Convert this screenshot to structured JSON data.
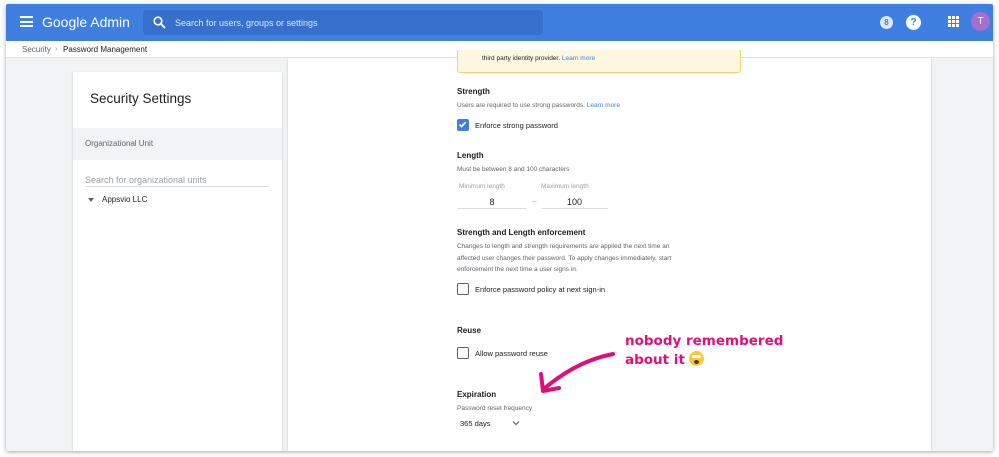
{
  "topbar": {
    "brand": "Google Admin",
    "search_placeholder": "Search for users, groups or settings",
    "notification_count": "8",
    "help_symbol": "?",
    "avatar_initial": "T",
    "color": "#3f7fe0",
    "icons": [
      "menu-icon",
      "search-icon",
      "help-icon",
      "apps-grid-icon"
    ]
  },
  "breadcrumb": {
    "items": [
      "Security",
      "Password Management"
    ],
    "separator": "›"
  },
  "sidebar": {
    "title": "Security Settings",
    "org_unit_label": "Organizational Unit",
    "search_placeholder": "Search for organizational units",
    "org_name": "Appsvio LLC"
  },
  "main": {
    "info_banner": {
      "text": "third party identity provider.",
      "link": "Learn more"
    },
    "strength": {
      "title": "Strength",
      "desc": "Users are required to use strong passwords.",
      "link": "Learn more",
      "checkbox_label": "Enforce strong password",
      "checked": true
    },
    "length": {
      "title": "Length",
      "desc": "Must be between 8 and 100 characters",
      "min_label": "Minimum length",
      "min_value": "8",
      "max_label": "Maximum length",
      "max_value": "100",
      "separator": "–"
    },
    "enforcement": {
      "title": "Strength and Length enforcement",
      "desc_lines": [
        "Changes to length and strength requirements are applied the next time an",
        "affected user changes their password. To apply changes immediately, start",
        "enforcement the next time a user signs in."
      ],
      "checkbox_label": "Enforce password policy at next sign-in",
      "checked": false
    },
    "reuse": {
      "title": "Reuse",
      "checkbox_label": "Allow password reuse",
      "checked": false
    },
    "expiration": {
      "title": "Expiration",
      "field_label": "Password reset frequency",
      "value": "365 days"
    }
  },
  "annotation": {
    "line1": "nobody remembered",
    "line2": "about it",
    "emoji": "face-screaming-in-fear",
    "color": "#e0107a"
  }
}
